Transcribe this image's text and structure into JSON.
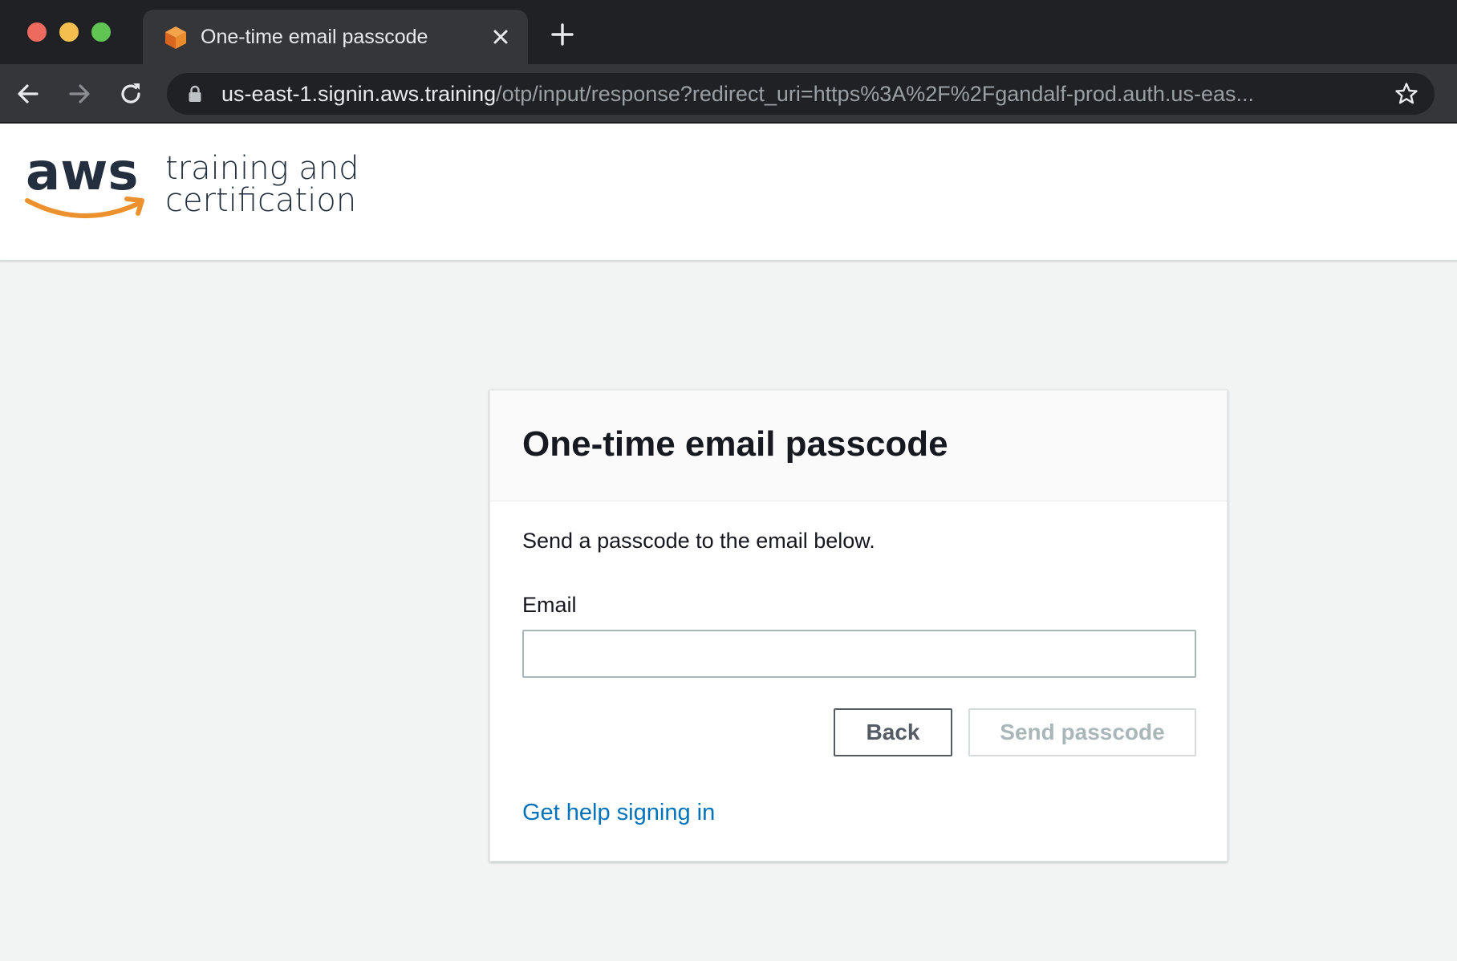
{
  "browser": {
    "tab": {
      "title": "One-time email passcode",
      "favicon": "aws-cube-icon"
    },
    "address_bar": {
      "host": "us-east-1.signin.aws.training",
      "path": "/otp/input/response?redirect_uri=https%3A%2F%2Fgandalf-prod.auth.us-eas..."
    }
  },
  "header": {
    "logo_word": "aws",
    "logo_text_line1": "training and",
    "logo_text_line2": "certification"
  },
  "card": {
    "title": "One-time email passcode",
    "intro": "Send a passcode to the email below.",
    "email_label": "Email",
    "email_value": "",
    "back_label": "Back",
    "send_label": "Send passcode",
    "help_link": "Get help signing in"
  },
  "colors": {
    "link": "#0073bb",
    "aws_orange": "#ec912d",
    "aws_navy": "#232f3e"
  }
}
